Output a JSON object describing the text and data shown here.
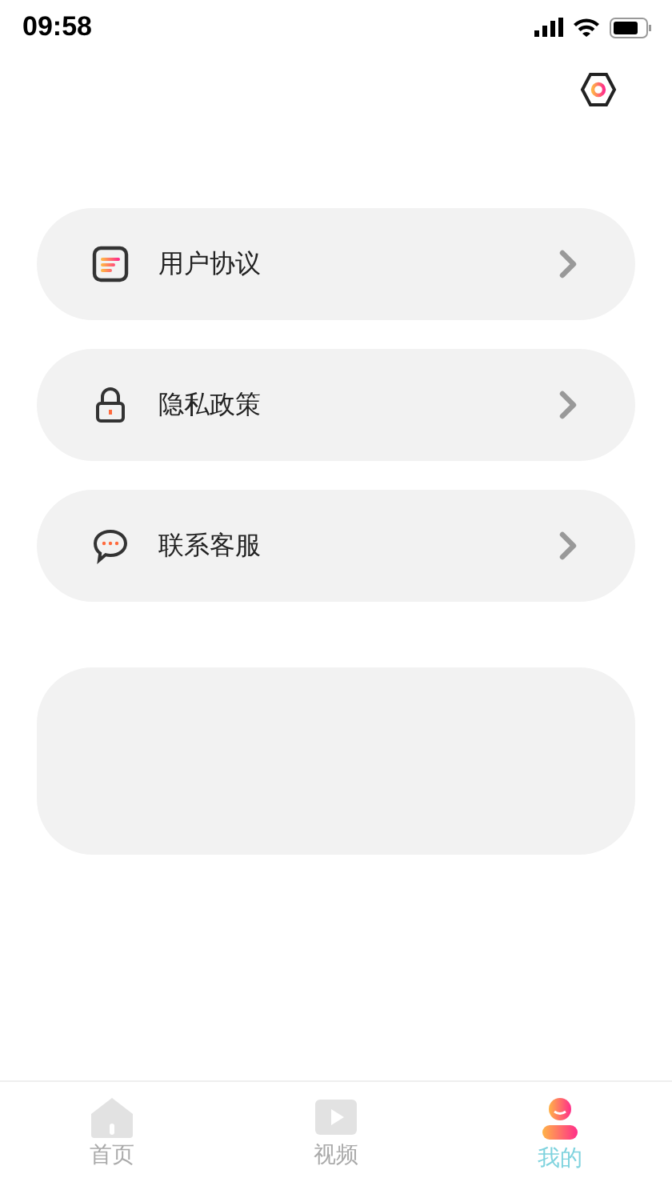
{
  "status_bar": {
    "time": "09:58"
  },
  "menu": [
    {
      "kind": "document",
      "label": "用户协议"
    },
    {
      "kind": "lock",
      "label": "隐私政策"
    },
    {
      "kind": "chat",
      "label": "联系客服"
    }
  ],
  "tab_bar": [
    {
      "kind": "home",
      "label": "首页",
      "selected": false
    },
    {
      "kind": "video",
      "label": "视频",
      "selected": false
    },
    {
      "kind": "profile",
      "label": "我的",
      "selected": true
    }
  ]
}
